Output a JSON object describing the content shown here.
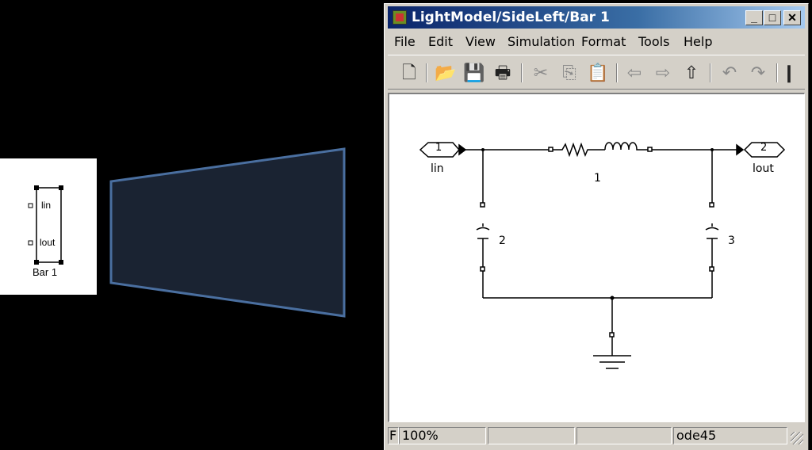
{
  "block": {
    "name": "Bar 1",
    "port_in": "lin",
    "port_out": "lout"
  },
  "window": {
    "title": "LightModel/SideLeft/Bar 1",
    "controls": {
      "minimize": "_",
      "maximize": "□",
      "close": "✕"
    }
  },
  "menu": [
    "File",
    "Edit",
    "View",
    "Simulation",
    "Format",
    "Tools",
    "Help"
  ],
  "toolbar": {
    "icons": [
      "new-file-icon",
      "open-folder-icon",
      "save-icon",
      "print-icon",
      "cut-icon",
      "copy-icon",
      "paste-icon",
      "back-arrow-icon",
      "forward-arrow-icon",
      "up-arrow-icon",
      "undo-icon",
      "redo-icon",
      "more-icon"
    ]
  },
  "diagram": {
    "inport_number": "1",
    "inport_label": "lin",
    "outport_number": "2",
    "outport_label": "lout",
    "series_element_label": "1",
    "cap_left_label": "2",
    "cap_right_label": "3"
  },
  "status": {
    "left": "F",
    "zoom": "100%",
    "solver": "ode45"
  },
  "colors": {
    "titlebar_start": "#0a246a",
    "titlebar_end": "#a6caf0",
    "chrome": "#d4d0c8",
    "zoom_fill": "#1a2332",
    "zoom_stroke": "#4a6fa0"
  }
}
